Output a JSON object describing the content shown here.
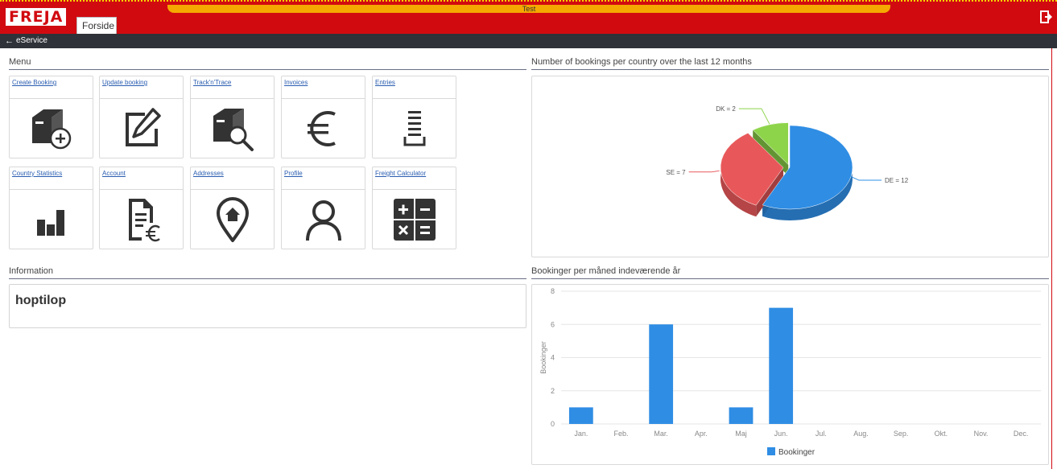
{
  "header": {
    "env_label": "Test",
    "logo_text": "FREJA",
    "tab_label": "Forside"
  },
  "nav": {
    "back_symbol": "←",
    "breadcrumb": "eService"
  },
  "menu": {
    "heading": "Menu",
    "tiles": [
      {
        "label": "Create Booking",
        "icon": "box-add-icon"
      },
      {
        "label": "Update booking",
        "icon": "edit-icon"
      },
      {
        "label": "Track'n'Trace",
        "icon": "box-search-icon"
      },
      {
        "label": "Invoices",
        "icon": "euro-icon"
      },
      {
        "label": "Entries",
        "icon": "list-icon"
      },
      {
        "label": "Country Statistics",
        "icon": "bar-chart-icon"
      },
      {
        "label": "Account",
        "icon": "document-euro-icon"
      },
      {
        "label": "Addresses",
        "icon": "location-home-icon"
      },
      {
        "label": "Profile",
        "icon": "user-icon"
      },
      {
        "label": "Freight Calculator",
        "icon": "calculator-icon"
      }
    ]
  },
  "information": {
    "heading": "Information",
    "text": "hoptilop"
  },
  "pie_section": {
    "heading": "Number of bookings per country over the last 12 months"
  },
  "bar_section": {
    "heading": "Bookinger per måned indeværende år"
  },
  "chart_data": [
    {
      "type": "pie",
      "title": "Number of bookings per country over the last 12 months",
      "slices": [
        {
          "label": "DE = 12",
          "name": "DE",
          "value": 12,
          "color": "#2f8de4"
        },
        {
          "label": "SE = 7",
          "name": "SE",
          "value": 7,
          "color": "#e8585a"
        },
        {
          "label": "DK = 2",
          "name": "DK",
          "value": 2,
          "color": "#8ed44a"
        }
      ]
    },
    {
      "type": "bar",
      "title": "Bookinger per måned indeværende år",
      "categories": [
        "Jan.",
        "Feb.",
        "Mar.",
        "Apr.",
        "Maj",
        "Jun.",
        "Jul.",
        "Aug.",
        "Sep.",
        "Okt.",
        "Nov.",
        "Dec."
      ],
      "series": [
        {
          "name": "Bookinger",
          "values": [
            1,
            0,
            6,
            0,
            1,
            7,
            0,
            0,
            0,
            0,
            0,
            0
          ],
          "color": "#2f8de4"
        }
      ],
      "ylabel": "Bookinger",
      "ylim": [
        0,
        8
      ],
      "yticks": [
        "0",
        "2",
        "4",
        "6",
        "8"
      ],
      "grid": true,
      "legend": "bottom"
    }
  ]
}
